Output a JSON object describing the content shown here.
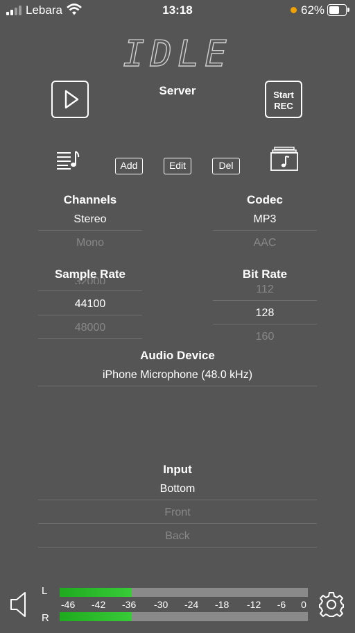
{
  "status_bar": {
    "carrier": "Lebara",
    "time": "13:18",
    "battery": "62%"
  },
  "display": {
    "state": "IDLE"
  },
  "header": {
    "server_label": "Server",
    "start_rec_line1": "Start",
    "start_rec_line2": "REC"
  },
  "toolbar": {
    "add": "Add",
    "edit": "Edit",
    "del": "Del"
  },
  "channels": {
    "title": "Channels",
    "selected": "Stereo",
    "next": "Mono"
  },
  "codec": {
    "title": "Codec",
    "selected": "MP3",
    "next": "AAC"
  },
  "sample_rate": {
    "title": "Sample Rate",
    "prev": "32000",
    "selected": "44100",
    "next": "48000"
  },
  "bit_rate": {
    "title": "Bit Rate",
    "prev": "112",
    "selected": "128",
    "next": "160"
  },
  "audio_device": {
    "title": "Audio Device",
    "value": "iPhone Microphone (48.0 kHz)"
  },
  "input": {
    "title": "Input",
    "selected": "Bottom",
    "option2": "Front",
    "option3": "Back"
  },
  "meter": {
    "left_label": "L",
    "right_label": "R",
    "scale": [
      "-46",
      "-42",
      "-36",
      "-30",
      "-24",
      "-18",
      "-12",
      "-6",
      "0"
    ],
    "left_level": 0.29,
    "right_level": 0.29,
    "level_color": "#22bb22",
    "track_color": "#8a8a8a"
  },
  "icons": {
    "volume": "speaker-icon",
    "settings": "gear-icon",
    "playlist": "playlist-icon",
    "library": "music-library-icon"
  }
}
